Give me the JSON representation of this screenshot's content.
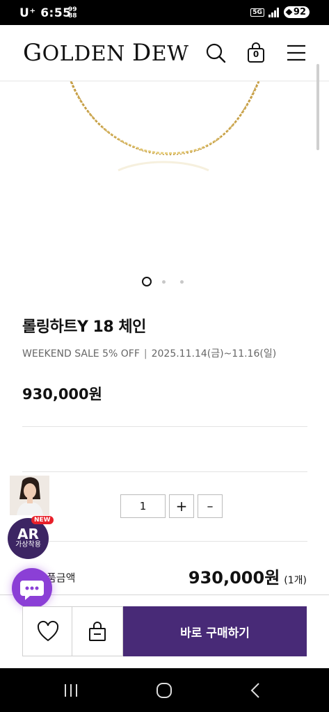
{
  "status_bar": {
    "carrier_time": "U⁺ 6:55",
    "extra_top": "99",
    "extra_bottom": "88",
    "network": "5G",
    "battery": "92"
  },
  "header": {
    "brand_first": "G",
    "brand_rest1": "OLDEN ",
    "brand_cap2": "D",
    "brand_rest2": "EW",
    "search_icon": "search-icon",
    "cart_icon": "shopping-bag-icon",
    "cart_count": "0",
    "menu_icon": "hamburger-menu-icon"
  },
  "gallery": {
    "slide_count": 3,
    "active_slide": 1
  },
  "product": {
    "title": "롤링하트Y 18 체인",
    "promo_label": "WEEKEND SALE 5% OFF",
    "promo_sep": "|",
    "promo_period": "2025.11.14(금)~11.16(일)",
    "price": "930,000원"
  },
  "quantity": {
    "value": "1",
    "plus": "+",
    "minus": "–"
  },
  "total": {
    "label": "총 상품금액",
    "label_visible": "품금액",
    "price": "930,000원",
    "count": "(1개)"
  },
  "floating": {
    "ar_title": "AR",
    "ar_sub": "가상착용",
    "new_tag": "NEW",
    "chat_icon": "chat-bubble-icon"
  },
  "actions": {
    "wish_icon": "heart-icon",
    "cart_icon": "shopping-bag-minus-icon",
    "buy_label": "바로 구매하기"
  },
  "colors": {
    "primary": "#482a77",
    "ar_badge": "#3c2563",
    "chat": "#8b3fd6",
    "new_tag": "#e8202a"
  }
}
